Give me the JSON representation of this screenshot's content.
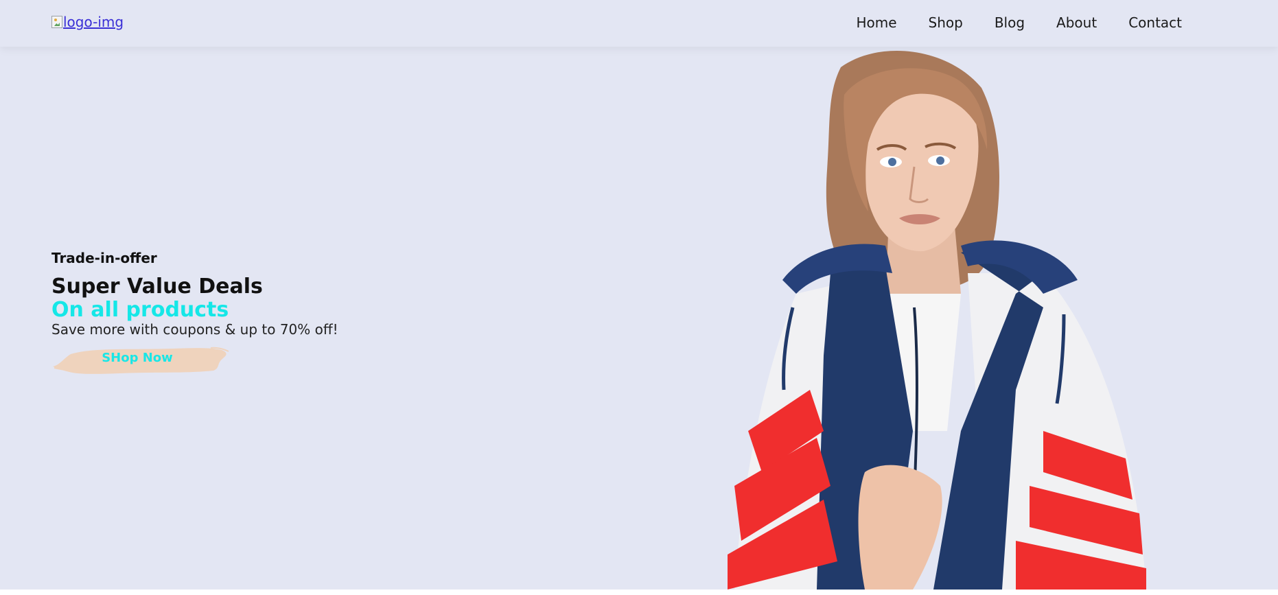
{
  "header": {
    "logo_alt": "logo-img",
    "nav": [
      {
        "label": "Home"
      },
      {
        "label": "Shop"
      },
      {
        "label": "Blog"
      },
      {
        "label": "About"
      },
      {
        "label": "Contact"
      }
    ]
  },
  "hero": {
    "eyebrow": "Trade-in-offer",
    "headline": "Super Value Deals",
    "subheadline": "On all products",
    "copy": "Save more with coupons & up to 70% off!",
    "cta_label": "SHop Now"
  },
  "colors": {
    "background": "#e3e6f3",
    "accent_cyan": "#15e7e7",
    "cta_brush": "#efd3bd",
    "text_dark": "#111111"
  },
  "icons": {
    "logo": "broken-image-icon"
  }
}
